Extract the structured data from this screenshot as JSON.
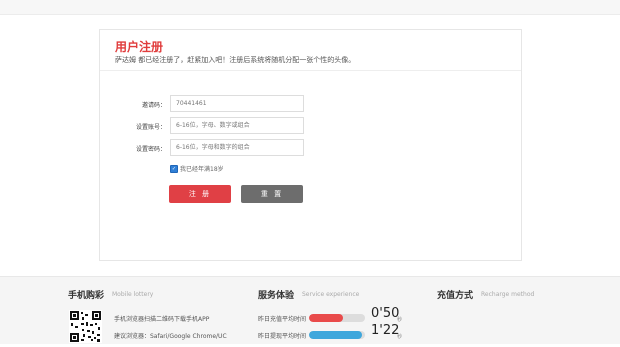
{
  "register": {
    "title": "用户注册",
    "subtitle": "萨达姆 都已经注册了，赶紧加入吧！注册后系统将随机分配一张个性的头像。",
    "fields": [
      {
        "label": "邀请码：",
        "value": "",
        "placeholder": "70441461"
      },
      {
        "label": "设置账号：",
        "value": "",
        "placeholder": "6-16位，字母、数字或组合"
      },
      {
        "label": "设置密码：",
        "value": "",
        "placeholder": "6-16位，字母和数字的组合"
      }
    ],
    "agree_label": "我已经年满18岁",
    "agree_checked": true,
    "submit_label": "注 册",
    "reset_label": "重 置"
  },
  "footer": {
    "mobile": {
      "title": "手机购彩",
      "subtitle": "Mobile lottery",
      "line1": "手机浏览器扫描二维码下载手机APP",
      "line2": "建议浏览器：Safari/Google Chrome/UC"
    },
    "service": {
      "title": "服务体验",
      "subtitle": "Service experience",
      "items": [
        {
          "label": "昨日充值平均时间",
          "value": "0'50",
          "unit": "秒",
          "fill": 0.6,
          "color": "#e94b4b"
        },
        {
          "label": "昨日提现平均时间",
          "value": "1'22",
          "unit": "秒",
          "fill": 0.95,
          "color": "#3fa7dc"
        }
      ]
    },
    "recharge": {
      "title": "充值方式",
      "subtitle": "Recharge method"
    }
  }
}
